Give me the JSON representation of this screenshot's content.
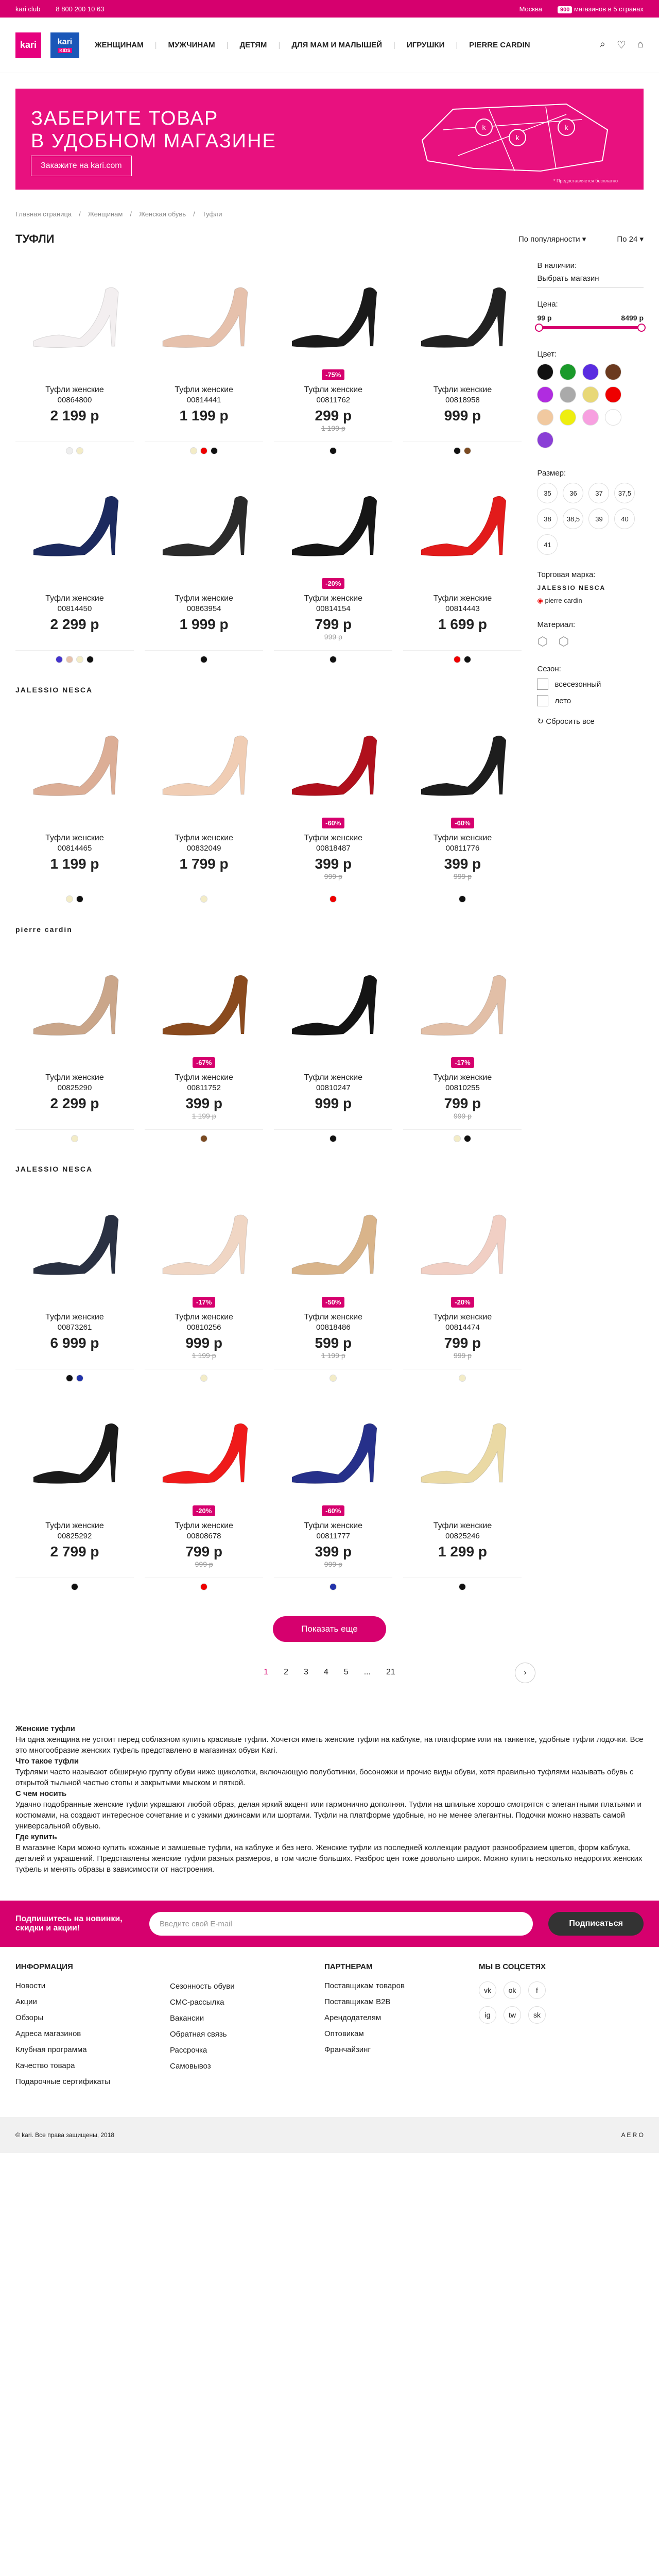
{
  "topbar": {
    "club": "kari club",
    "phone": "8 800 200 10 63",
    "city": "Москва",
    "stores_count": "900",
    "stores_text": "магазинов в 5 странах"
  },
  "logo": {
    "kari": "kari",
    "kids": "kari",
    "kids_sub": "KIDS"
  },
  "menu": [
    "ЖЕНЩИНАМ",
    "МУЖЧИНАМ",
    "ДЕТЯМ",
    "ДЛЯ МАМ И МАЛЫШЕЙ",
    "ИГРУШКИ",
    "PIERRE CARDIN"
  ],
  "banner": {
    "line1": "ЗАБЕРИТЕ ТОВАР",
    "line2": "В УДОБНОМ МАГАЗИНЕ",
    "button": "Закажите на kari.com",
    "note": "* Предоставляется бесплатно"
  },
  "crumbs": [
    "Главная страница",
    "Женщинам",
    "Женская обувь",
    "Туфли"
  ],
  "page": {
    "title": "ТУФЛИ",
    "sort": "По популярности",
    "per": "По 24"
  },
  "products": [
    {
      "name": "Туфли женские",
      "art": "00864800",
      "price": "2 199 р",
      "old": "",
      "disc": "",
      "color": "#f3eff0",
      "sw": [
        "#eee",
        "#f3ecc7"
      ]
    },
    {
      "name": "Туфли женские",
      "art": "00814441",
      "price": "1 199 р",
      "old": "",
      "disc": "",
      "color": "#e6c1ac",
      "sw": [
        "#f3ecc7",
        "#e00",
        "#111"
      ]
    },
    {
      "name": "Туфли женские",
      "art": "00811762",
      "price": "299 р",
      "old": "1 199 р",
      "disc": "-75%",
      "color": "#1a1a1a",
      "sw": [
        "#111"
      ]
    },
    {
      "name": "Туфли женские",
      "art": "00818958",
      "price": "999 р",
      "old": "",
      "disc": "",
      "color": "#222",
      "sw": [
        "#111",
        "#7a4a22"
      ]
    },
    {
      "name": "Туфли женские",
      "art": "00814450",
      "price": "2 299 р",
      "old": "",
      "disc": "",
      "color": "#1c2a5e",
      "sw": [
        "#4433cc",
        "#e6c1ac",
        "#f3ecc7",
        "#111"
      ]
    },
    {
      "name": "Туфли женские",
      "art": "00863954",
      "price": "1 999 р",
      "old": "",
      "disc": "",
      "color": "#2b2b2b",
      "sw": [
        "#111"
      ]
    },
    {
      "name": "Туфли женские",
      "art": "00814154",
      "price": "799 р",
      "old": "999 р",
      "disc": "-20%",
      "color": "#161616",
      "sw": [
        "#111"
      ]
    },
    {
      "name": "Туфли женские",
      "art": "00814443",
      "price": "1 699 р",
      "old": "",
      "disc": "",
      "color": "#e21b1b",
      "sw": [
        "#e00",
        "#111"
      ]
    },
    {
      "name": "Туфли женские",
      "art": "00814465",
      "price": "1 199 р",
      "old": "",
      "disc": "",
      "color": "#dcae96",
      "sw": [
        "#f3ecc7",
        "#111"
      ]
    },
    {
      "name": "Туфли женские",
      "art": "00832049",
      "price": "1 799 р",
      "old": "",
      "disc": "",
      "color": "#f0cdb4",
      "sw": [
        "#f3ecc7"
      ]
    },
    {
      "name": "Туфли женские",
      "art": "00818487",
      "price": "399 р",
      "old": "999 р",
      "disc": "-60%",
      "color": "#b0101c",
      "sw": [
        "#e00"
      ]
    },
    {
      "name": "Туфли женские",
      "art": "00811776",
      "price": "399 р",
      "old": "999 р",
      "disc": "-60%",
      "color": "#1d1d1d",
      "sw": [
        "#111"
      ]
    },
    {
      "name": "Туфли женские",
      "art": "00825290",
      "price": "2 299 р",
      "old": "",
      "disc": "",
      "color": "#caa68a",
      "sw": [
        "#f3ecc7"
      ]
    },
    {
      "name": "Туфли женские",
      "art": "00811752",
      "price": "399 р",
      "old": "1 199 р",
      "disc": "-67%",
      "color": "#8a4a1e",
      "sw": [
        "#7a4a22"
      ]
    },
    {
      "name": "Туфли женские",
      "art": "00810247",
      "price": "999 р",
      "old": "",
      "disc": "",
      "color": "#141414",
      "sw": [
        "#111"
      ]
    },
    {
      "name": "Туфли женские",
      "art": "00810255",
      "price": "799 р",
      "old": "999 р",
      "disc": "-17%",
      "color": "#e2bfa7",
      "sw": [
        "#f3ecc7",
        "#111"
      ]
    },
    {
      "name": "Туфли женские",
      "art": "00873261",
      "price": "6 999 р",
      "old": "",
      "disc": "",
      "color": "#2a3142",
      "sw": [
        "#111",
        "#2233aa"
      ]
    },
    {
      "name": "Туфли женские",
      "art": "00810256",
      "price": "999 р",
      "old": "1 199 р",
      "disc": "-17%",
      "color": "#f0d6c4",
      "sw": [
        "#f3ecc7"
      ]
    },
    {
      "name": "Туфли женские",
      "art": "00818486",
      "price": "599 р",
      "old": "1 199 р",
      "disc": "-50%",
      "color": "#d9b48a",
      "sw": [
        "#f3ecc7"
      ]
    },
    {
      "name": "Туфли женские",
      "art": "00814474",
      "price": "799 р",
      "old": "999 р",
      "disc": "-20%",
      "color": "#f1cfc4",
      "sw": [
        "#f3ecc7"
      ]
    },
    {
      "name": "Туфли женские",
      "art": "00825292",
      "price": "2 799 р",
      "old": "",
      "disc": "",
      "color": "#1a1a1a",
      "sw": [
        "#111"
      ]
    },
    {
      "name": "Туфли женские",
      "art": "00808678",
      "price": "799 р",
      "old": "999 р",
      "disc": "-20%",
      "color": "#ef1a1a",
      "sw": [
        "#e00"
      ]
    },
    {
      "name": "Туфли женские",
      "art": "00811777",
      "price": "399 р",
      "old": "999 р",
      "disc": "-60%",
      "color": "#26308a",
      "sw": [
        "#2233aa"
      ]
    },
    {
      "name": "Туфли женские",
      "art": "00825246",
      "price": "1 299 р",
      "old": "",
      "disc": "",
      "color": "#ead9a4",
      "sw": [
        "#111"
      ]
    }
  ],
  "brand_rows": {
    "r3": "JALESSIO NESCA",
    "r4": "pierre cardin",
    "r5": "JALESSIO NESCA"
  },
  "filter": {
    "availability_label": "В наличии:",
    "availability_value": "Выбрать магазин",
    "price_label": "Цена:",
    "price_min": "99 р",
    "price_max": "8499 р",
    "color_label": "Цвет:",
    "colors": [
      "#111",
      "#1a9a2a",
      "#5a2ce0",
      "#6b3a1f",
      "#b02ce0",
      "#aaa",
      "#e8d877",
      "#e00",
      "#f1c9a0",
      "#eeee10",
      "#f7a0e0",
      "#fff",
      "#8a3fd6"
    ],
    "size_label": "Размер:",
    "sizes": [
      "35",
      "36",
      "37",
      "37,5",
      "38",
      "38,5",
      "39",
      "40",
      "41"
    ],
    "brand_label": "Торговая марка:",
    "brand1": "JALESSIO NESCA",
    "brand2": "pierre cardin",
    "material_label": "Материал:",
    "season_label": "Сезон:",
    "seasons": [
      "всесезонный",
      "лето"
    ],
    "reset": "Сбросить все"
  },
  "more_button": "Показать еще",
  "pagination": [
    "1",
    "2",
    "3",
    "4",
    "5",
    "...",
    "21"
  ],
  "seo": {
    "h1": "Женские туфли",
    "p1": "Ни одна женщина не устоит перед соблазном купить красивые туфли. Хочется иметь женские туфли на каблуке, на платформе или на танкетке, удобные туфли лодочки. Все это многообразие женских туфель представлено в магазинах обуви Kari.",
    "h2": "Что такое туфли",
    "p2": "Туфлями часто называют обширную группу обуви ниже щиколотки, включающую полуботинки, босоножки и прочие виды обуви, хотя правильно туфлями называть обувь с открытой тыльной частью стопы и закрытыми мыском и пяткой.",
    "h3": "С чем носить",
    "p3": "Удачно подобранные женские туфли украшают любой образ, делая яркий акцент или гармонично дополняя. Туфли на шпильке хорошо смотрятся с элегантными платьями и костюмами, на создают интересное сочетание и с узкими джинсами или шортами. Туфли на платформе удобные, но не менее элегантны. Подочки можно назвать самой универсальной обувью.",
    "h4": "Где купить",
    "p4": "В магазине Кари можно купить кожаные и замшевые туфли, на каблуке и без него. Женские туфли из последней коллекции радуют разнообразием цветов, форм каблука, деталей и украшений. Представлены женские туфли разных размеров, в том числе больших. Разброс цен тоже довольно широк. Можно купить несколько недорогих женских туфель и менять образы в зависимости от настроения."
  },
  "subscribe": {
    "text": "Подпишитесь на новинки, скидки и акции!",
    "placeholder": "Введите свой E-mail",
    "button": "Подписаться"
  },
  "footer": {
    "info_title": "ИНФОРМАЦИЯ",
    "info_col1": [
      "Новости",
      "Акции",
      "Обзоры",
      "Адреса магазинов",
      "Клубная программа",
      "Качество товара",
      "Подарочные сертификаты"
    ],
    "info_col2": [
      "Сезонность обуви",
      "СМС-рассылка",
      "Вакансии",
      "Обратная связь",
      "Рассрочка",
      "Самовывоз"
    ],
    "partners_title": "ПАРТНЕРАМ",
    "partners": [
      "Поставщикам товаров",
      "Поставщикам B2B",
      "Арендодателям",
      "Оптовикам",
      "Франчайзинг"
    ],
    "social_title": "МЫ В СОЦСЕТЯХ",
    "social": [
      "vk",
      "ok",
      "f",
      "ig",
      "tw",
      "sk"
    ]
  },
  "copyright": "© kari. Все права защищены, 2018",
  "maker": "A E R O"
}
